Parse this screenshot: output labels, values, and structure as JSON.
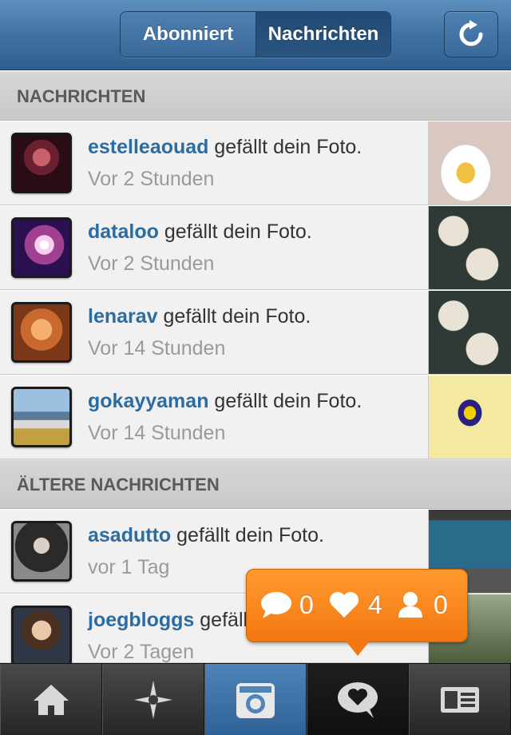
{
  "header": {
    "tabs": [
      {
        "label": "Abonniert",
        "active": false
      },
      {
        "label": "Nachrichten",
        "active": true
      }
    ],
    "refresh_icon": "refresh-icon"
  },
  "sections": {
    "recent": "NACHRICHTEN",
    "older": "ÄLTERE NACHRICHTEN"
  },
  "recent_items": [
    {
      "user": "estelleaouad",
      "action": "gefällt dein Foto.",
      "time": "Vor 2 Stunden"
    },
    {
      "user": "dataloo",
      "action": "gefällt dein Foto.",
      "time": "Vor 2 Stunden"
    },
    {
      "user": "lenarav",
      "action": "gefällt dein Foto.",
      "time": "Vor 14 Stunden"
    },
    {
      "user": "gokayyaman",
      "action": "gefällt dein Foto.",
      "time": "Vor 14 Stunden"
    }
  ],
  "older_items": [
    {
      "user": "asadutto",
      "action": "gefällt dein Foto.",
      "time": "vor 1 Tag"
    },
    {
      "user": "joegbloggs",
      "action": "gefällt dein Foto.",
      "time": "Vor 2 Tagen"
    }
  ],
  "notification_bubble": {
    "comments": "0",
    "likes": "4",
    "followers": "0",
    "color": "#f58a1f"
  },
  "tabbar": {
    "items": [
      {
        "icon": "home-icon"
      },
      {
        "icon": "explore-star-icon"
      },
      {
        "icon": "camera-icon"
      },
      {
        "icon": "news-heart-bubble-icon",
        "active": true
      },
      {
        "icon": "profile-card-icon"
      }
    ]
  },
  "colors": {
    "header_blue": "#3f72a3",
    "username_blue": "#2b6ca3",
    "bubble_orange": "#f58a1f"
  }
}
